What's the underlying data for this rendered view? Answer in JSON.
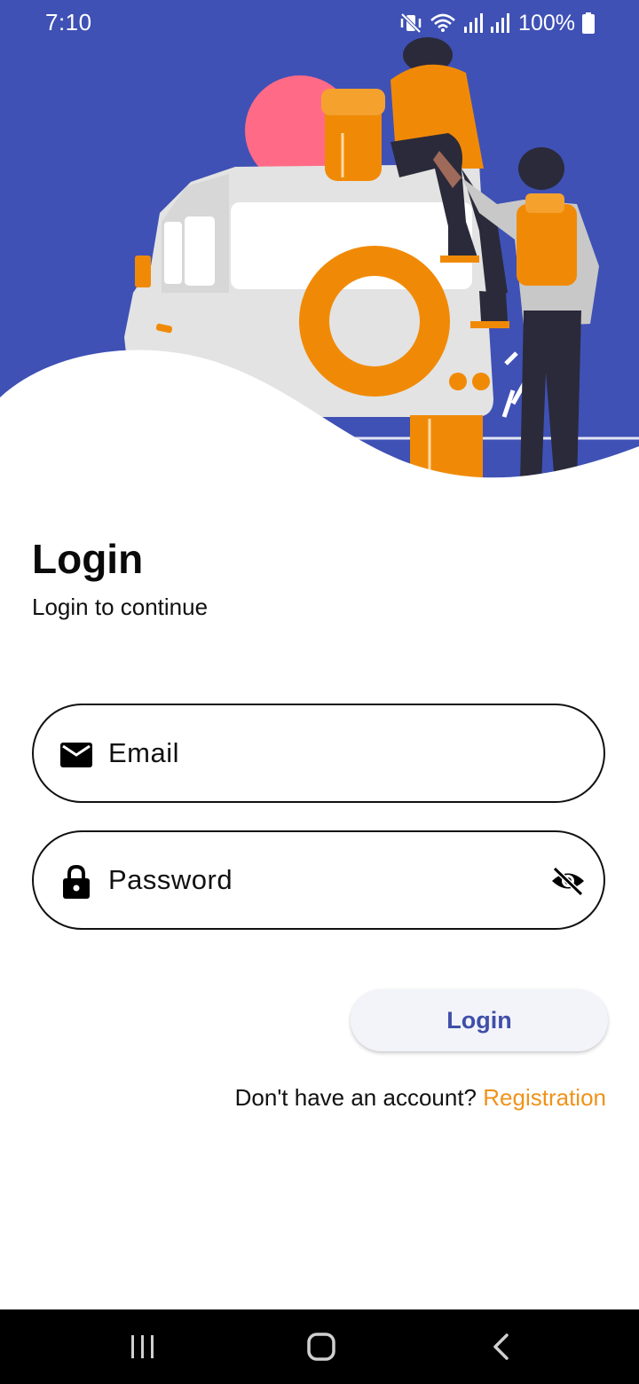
{
  "status_bar": {
    "time": "7:10",
    "battery": "100%",
    "icons": [
      "vibrate-off-icon",
      "wifi-icon",
      "signal-icon",
      "signal-icon",
      "battery-icon"
    ]
  },
  "header": {
    "illustration": "travelers-jeep-illustration",
    "background_color": "#3f51b5",
    "accent_color": "#f08a06"
  },
  "login": {
    "title": "Login",
    "subtitle": "Login to continue",
    "email": {
      "placeholder": "Email",
      "value": "",
      "icon": "mail-icon"
    },
    "password": {
      "placeholder": "Password",
      "value": "",
      "icon": "lock-icon",
      "toggle_icon": "eye-off-icon"
    },
    "button_label": "Login",
    "button_color": "#3f4fa8",
    "register_prompt": "Don't have an account?",
    "register_link": "Registration",
    "link_color": "#f0921a"
  },
  "nav_bar": {
    "buttons": [
      "recents-icon",
      "home-icon",
      "back-icon"
    ]
  }
}
